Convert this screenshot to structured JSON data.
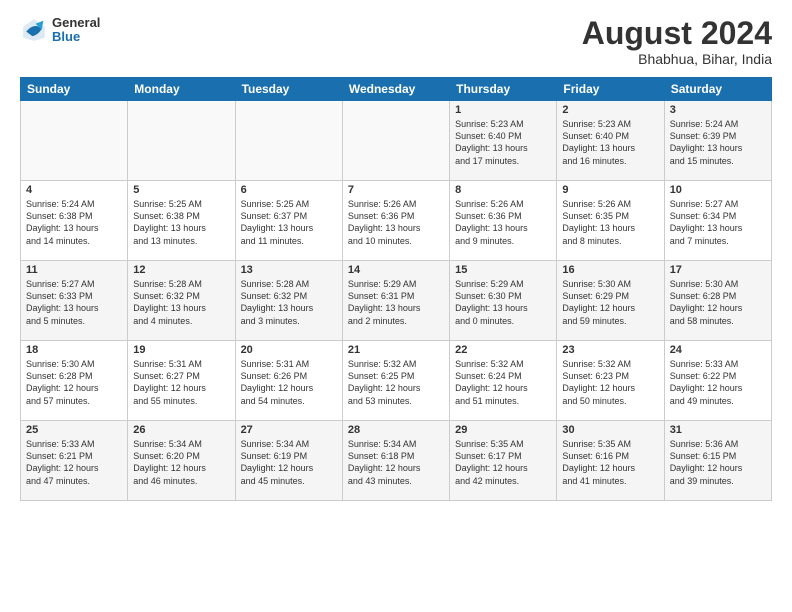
{
  "logo": {
    "general": "General",
    "blue": "Blue"
  },
  "title": "August 2024",
  "subtitle": "Bhabhua, Bihar, India",
  "headers": [
    "Sunday",
    "Monday",
    "Tuesday",
    "Wednesday",
    "Thursday",
    "Friday",
    "Saturday"
  ],
  "weeks": [
    [
      {
        "day": "",
        "info": ""
      },
      {
        "day": "",
        "info": ""
      },
      {
        "day": "",
        "info": ""
      },
      {
        "day": "",
        "info": ""
      },
      {
        "day": "1",
        "info": "Sunrise: 5:23 AM\nSunset: 6:40 PM\nDaylight: 13 hours\nand 17 minutes."
      },
      {
        "day": "2",
        "info": "Sunrise: 5:23 AM\nSunset: 6:40 PM\nDaylight: 13 hours\nand 16 minutes."
      },
      {
        "day": "3",
        "info": "Sunrise: 5:24 AM\nSunset: 6:39 PM\nDaylight: 13 hours\nand 15 minutes."
      }
    ],
    [
      {
        "day": "4",
        "info": "Sunrise: 5:24 AM\nSunset: 6:38 PM\nDaylight: 13 hours\nand 14 minutes."
      },
      {
        "day": "5",
        "info": "Sunrise: 5:25 AM\nSunset: 6:38 PM\nDaylight: 13 hours\nand 13 minutes."
      },
      {
        "day": "6",
        "info": "Sunrise: 5:25 AM\nSunset: 6:37 PM\nDaylight: 13 hours\nand 11 minutes."
      },
      {
        "day": "7",
        "info": "Sunrise: 5:26 AM\nSunset: 6:36 PM\nDaylight: 13 hours\nand 10 minutes."
      },
      {
        "day": "8",
        "info": "Sunrise: 5:26 AM\nSunset: 6:36 PM\nDaylight: 13 hours\nand 9 minutes."
      },
      {
        "day": "9",
        "info": "Sunrise: 5:26 AM\nSunset: 6:35 PM\nDaylight: 13 hours\nand 8 minutes."
      },
      {
        "day": "10",
        "info": "Sunrise: 5:27 AM\nSunset: 6:34 PM\nDaylight: 13 hours\nand 7 minutes."
      }
    ],
    [
      {
        "day": "11",
        "info": "Sunrise: 5:27 AM\nSunset: 6:33 PM\nDaylight: 13 hours\nand 5 minutes."
      },
      {
        "day": "12",
        "info": "Sunrise: 5:28 AM\nSunset: 6:32 PM\nDaylight: 13 hours\nand 4 minutes."
      },
      {
        "day": "13",
        "info": "Sunrise: 5:28 AM\nSunset: 6:32 PM\nDaylight: 13 hours\nand 3 minutes."
      },
      {
        "day": "14",
        "info": "Sunrise: 5:29 AM\nSunset: 6:31 PM\nDaylight: 13 hours\nand 2 minutes."
      },
      {
        "day": "15",
        "info": "Sunrise: 5:29 AM\nSunset: 6:30 PM\nDaylight: 13 hours\nand 0 minutes."
      },
      {
        "day": "16",
        "info": "Sunrise: 5:30 AM\nSunset: 6:29 PM\nDaylight: 12 hours\nand 59 minutes."
      },
      {
        "day": "17",
        "info": "Sunrise: 5:30 AM\nSunset: 6:28 PM\nDaylight: 12 hours\nand 58 minutes."
      }
    ],
    [
      {
        "day": "18",
        "info": "Sunrise: 5:30 AM\nSunset: 6:28 PM\nDaylight: 12 hours\nand 57 minutes."
      },
      {
        "day": "19",
        "info": "Sunrise: 5:31 AM\nSunset: 6:27 PM\nDaylight: 12 hours\nand 55 minutes."
      },
      {
        "day": "20",
        "info": "Sunrise: 5:31 AM\nSunset: 6:26 PM\nDaylight: 12 hours\nand 54 minutes."
      },
      {
        "day": "21",
        "info": "Sunrise: 5:32 AM\nSunset: 6:25 PM\nDaylight: 12 hours\nand 53 minutes."
      },
      {
        "day": "22",
        "info": "Sunrise: 5:32 AM\nSunset: 6:24 PM\nDaylight: 12 hours\nand 51 minutes."
      },
      {
        "day": "23",
        "info": "Sunrise: 5:32 AM\nSunset: 6:23 PM\nDaylight: 12 hours\nand 50 minutes."
      },
      {
        "day": "24",
        "info": "Sunrise: 5:33 AM\nSunset: 6:22 PM\nDaylight: 12 hours\nand 49 minutes."
      }
    ],
    [
      {
        "day": "25",
        "info": "Sunrise: 5:33 AM\nSunset: 6:21 PM\nDaylight: 12 hours\nand 47 minutes."
      },
      {
        "day": "26",
        "info": "Sunrise: 5:34 AM\nSunset: 6:20 PM\nDaylight: 12 hours\nand 46 minutes."
      },
      {
        "day": "27",
        "info": "Sunrise: 5:34 AM\nSunset: 6:19 PM\nDaylight: 12 hours\nand 45 minutes."
      },
      {
        "day": "28",
        "info": "Sunrise: 5:34 AM\nSunset: 6:18 PM\nDaylight: 12 hours\nand 43 minutes."
      },
      {
        "day": "29",
        "info": "Sunrise: 5:35 AM\nSunset: 6:17 PM\nDaylight: 12 hours\nand 42 minutes."
      },
      {
        "day": "30",
        "info": "Sunrise: 5:35 AM\nSunset: 6:16 PM\nDaylight: 12 hours\nand 41 minutes."
      },
      {
        "day": "31",
        "info": "Sunrise: 5:36 AM\nSunset: 6:15 PM\nDaylight: 12 hours\nand 39 minutes."
      }
    ]
  ]
}
